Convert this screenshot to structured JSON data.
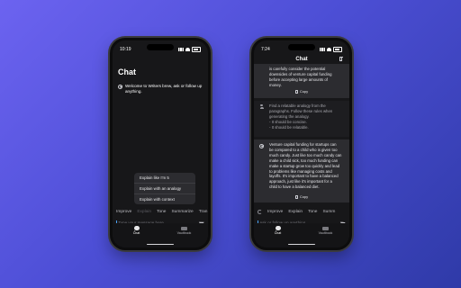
{
  "left_phone": {
    "time": "10:19",
    "title": "Chat",
    "welcome": "Welcome to Writers brew, ask or follow up anything.",
    "menu": [
      "Explain like I'm 5",
      "Explain with an analogy",
      "Explain with context"
    ],
    "chips": [
      "Improve",
      "Explain",
      "Tone",
      "Summarize",
      "Tran"
    ],
    "input_placeholder": "Type your message here",
    "tabs": [
      "Chat",
      "Vaultbook"
    ]
  },
  "right_phone": {
    "time": "7:24",
    "title": "Chat",
    "response_1_lines": [
      "is carefully consider the potential",
      "downsides of venture capital funding",
      "before accepting large amounts of",
      "money."
    ],
    "copy_label": "Copy",
    "prompt_lines": [
      "Find a relatable analogy from the",
      "paragraphs. Follow these rules when",
      "generating the analogy.",
      "- It should be concise.",
      "- It should be relatable."
    ],
    "response_2_lines": [
      "Venture capital funding for startups can",
      "be compared to a child who is given too",
      "much candy. Just like too much candy can",
      "make a child sick, too much funding can",
      "make a startup grow too quickly and lead",
      "to problems like managing costs and",
      "layoffs. It's important to have a balanced",
      "approach, just like it's important for a",
      "child to have a balanced diet."
    ],
    "chips": [
      "Improve",
      "Explain",
      "Tone",
      "Summ"
    ],
    "input_placeholder": "Ask or follow up anything...",
    "tabs": [
      "Chat",
      "Vaultbook"
    ]
  }
}
